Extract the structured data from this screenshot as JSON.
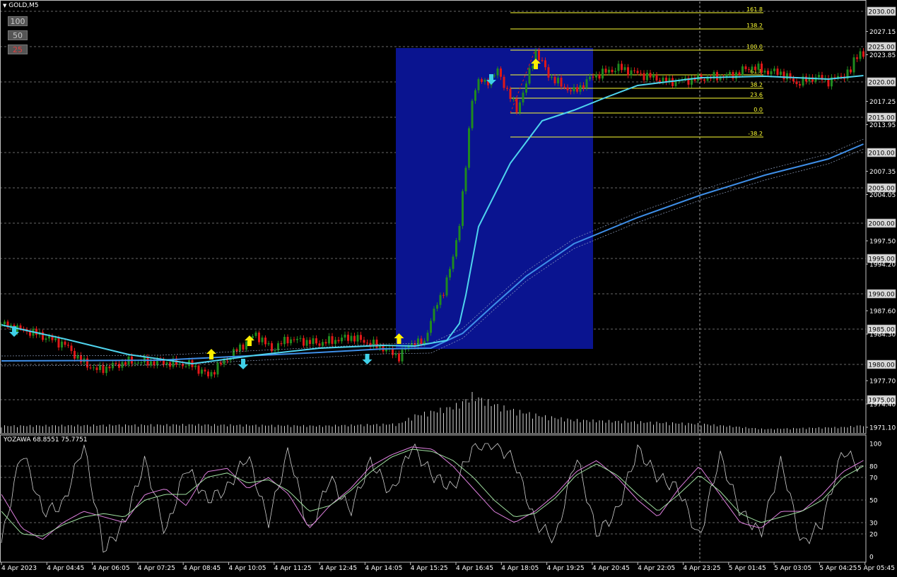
{
  "window": {
    "symbol_label": "GOLD,M5"
  },
  "zoom_buttons": [
    {
      "label": "100",
      "active": false
    },
    {
      "label": "50",
      "active": false
    },
    {
      "label": "25",
      "active": true
    }
  ],
  "price_axis": {
    "box_labels": [
      "2030.00",
      "2025.00",
      "2020.00",
      "2015.00",
      "2010.00",
      "2005.00",
      "2000.00",
      "1995.00",
      "1990.00",
      "1985.00",
      "1980.00",
      "1975.00"
    ],
    "plain_labels": [
      "2027.15",
      "2023.85",
      "2017.25",
      "2013.95",
      "2007.35",
      "2004.05",
      "1997.50",
      "1994.20",
      "1987.60",
      "1984.30",
      "1977.70",
      "1974.40",
      "1971.10"
    ]
  },
  "time_axis": {
    "labels": [
      "4 Apr 2023",
      "4 Apr 04:45",
      "4 Apr 06:05",
      "4 Apr 07:25",
      "4 Apr 08:45",
      "4 Apr 10:05",
      "4 Apr 11:25",
      "4 Apr 12:45",
      "4 Apr 14:05",
      "4 Apr 15:25",
      "4 Apr 16:45",
      "4 Apr 18:05",
      "4 Apr 19:25",
      "4 Apr 20:45",
      "4 Apr 22:05",
      "4 Apr 23:25",
      "5 Apr 01:45",
      "5 Apr 03:05",
      "5 Apr 04:25",
      "5 Apr 05:45"
    ]
  },
  "fibonacci": {
    "levels": [
      {
        "label": "161.8",
        "price": 2029.8
      },
      {
        "label": "138.2",
        "price": 2027.5
      },
      {
        "label": "100.0",
        "price": 2024.5
      },
      {
        "label": "61.8",
        "price": 2021.0
      },
      {
        "label": "38.2",
        "price": 2019.1
      },
      {
        "label": "23.6",
        "price": 2017.7
      },
      {
        "label": "0.0",
        "price": 2015.6
      },
      {
        "label": "-38.2",
        "price": 2012.2
      }
    ]
  },
  "oscillator": {
    "label": "YOZAWA 68.8551 75.7751",
    "axis_labels": [
      "100",
      "80",
      "70",
      "50",
      "30",
      "20",
      "0"
    ],
    "levels": [
      100,
      80,
      70,
      50,
      30,
      20,
      0
    ]
  },
  "colors": {
    "background": "#000000",
    "bull": "#1f8a1f",
    "bear": "#e01818",
    "fast_ma": "#4fd4ee",
    "slow_ma": "#3f8fe8",
    "fib": "#ffff33",
    "highlight_box": "#0a1490",
    "arrow_up": "#ffee00",
    "arrow_down": "#3fd0e8",
    "osc_main": "#d0d0d0",
    "osc_signal": "#e080e0",
    "osc_slow": "#a0e0a0"
  },
  "chart_data": {
    "type": "candlestick",
    "title": "GOLD,M5",
    "ylim": [
      1970.2,
      2031.4
    ],
    "close_path": [
      [
        0,
        1985.7
      ],
      [
        10,
        1984.5
      ],
      [
        20,
        1982.8
      ],
      [
        25,
        1980.5
      ],
      [
        30,
        1979.2
      ],
      [
        40,
        1980.4
      ],
      [
        50,
        1980.3
      ],
      [
        60,
        1979.9
      ],
      [
        65,
        1978.4
      ],
      [
        70,
        1980.5
      ],
      [
        80,
        1984.3
      ],
      [
        85,
        1982.1
      ],
      [
        90,
        1983.6
      ],
      [
        100,
        1983.0
      ],
      [
        110,
        1983.9
      ],
      [
        120,
        1982.3
      ],
      [
        125,
        1981.1
      ],
      [
        129,
        1983.1
      ],
      [
        133,
        1983.0
      ],
      [
        134,
        1985.0
      ],
      [
        136,
        1987.5
      ],
      [
        139,
        1990.5
      ],
      [
        142,
        1995.0
      ],
      [
        144,
        2000.2
      ],
      [
        146,
        2008.0
      ],
      [
        148,
        2017.8
      ],
      [
        150,
        2020.2
      ],
      [
        152,
        2019.8
      ],
      [
        156,
        2021.5
      ],
      [
        159,
        2018.8
      ],
      [
        162,
        2016.0
      ],
      [
        165,
        2019.8
      ],
      [
        168,
        2024.3
      ],
      [
        172,
        2021.0
      ],
      [
        176,
        2019.5
      ],
      [
        180,
        2018.6
      ],
      [
        186,
        2020.8
      ],
      [
        194,
        2022.0
      ],
      [
        200,
        2021.2
      ],
      [
        210,
        2020.0
      ],
      [
        220,
        2020.5
      ],
      [
        230,
        2021.0
      ],
      [
        236,
        2022.2
      ],
      [
        240,
        2021.5
      ],
      [
        245,
        2021.3
      ],
      [
        250,
        2019.8
      ],
      [
        256,
        2020.7
      ],
      [
        260,
        2020.1
      ],
      [
        264,
        2020.8
      ],
      [
        267,
        2021.5
      ],
      [
        268,
        2023.0
      ],
      [
        270,
        2024.5
      ],
      [
        271,
        2023.3
      ]
    ],
    "series": [
      {
        "name": "fast MA",
        "points": [
          [
            0,
            1985.6
          ],
          [
            20,
            1983.6
          ],
          [
            40,
            1981.4
          ],
          [
            60,
            1980.1
          ],
          [
            80,
            1981.3
          ],
          [
            100,
            1982.3
          ],
          [
            120,
            1982.7
          ],
          [
            130,
            1982.6
          ],
          [
            140,
            1983.4
          ],
          [
            144,
            1985.8
          ],
          [
            146,
            1989.8
          ],
          [
            150,
            1999.5
          ],
          [
            160,
            2008.5
          ],
          [
            170,
            2014.5
          ],
          [
            180,
            2016.0
          ],
          [
            190,
            2017.8
          ],
          [
            200,
            2019.5
          ],
          [
            220,
            2020.6
          ],
          [
            240,
            2020.8
          ],
          [
            260,
            2020.4
          ],
          [
            271,
            2020.9
          ]
        ]
      },
      {
        "name": "slow MA",
        "points": [
          [
            0,
            1980.5
          ],
          [
            50,
            1980.6
          ],
          [
            100,
            1981.7
          ],
          [
            120,
            1982.2
          ],
          [
            135,
            1982.3
          ],
          [
            145,
            1984.4
          ],
          [
            155,
            1988.5
          ],
          [
            165,
            1992.5
          ],
          [
            180,
            1997.1
          ],
          [
            200,
            2000.8
          ],
          [
            220,
            2004.0
          ],
          [
            240,
            2006.8
          ],
          [
            260,
            2009.1
          ],
          [
            271,
            2011.2
          ]
        ]
      }
    ],
    "highlight_range": {
      "x": [
        124,
        186
      ],
      "y": [
        1982.2,
        2024.8
      ]
    },
    "signals": [
      {
        "type": "down",
        "x": 4,
        "price": 1984.8
      },
      {
        "type": "up",
        "x": 66,
        "price": 1981.3
      },
      {
        "type": "up",
        "x": 78,
        "price": 1983.2
      },
      {
        "type": "down",
        "x": 76,
        "price": 1980.2
      },
      {
        "type": "down",
        "x": 115,
        "price": 1980.9
      },
      {
        "type": "up",
        "x": 125,
        "price": 1983.5
      },
      {
        "type": "down",
        "x": 154,
        "price": 2020.5
      },
      {
        "type": "up",
        "x": 168,
        "price": 2022.4
      }
    ],
    "volume_path": [
      [
        0,
        11
      ],
      [
        30,
        12
      ],
      [
        60,
        13
      ],
      [
        100,
        11
      ],
      [
        125,
        14
      ],
      [
        130,
        27
      ],
      [
        140,
        38
      ],
      [
        144,
        44
      ],
      [
        148,
        58
      ],
      [
        150,
        54
      ],
      [
        155,
        44
      ],
      [
        160,
        36
      ],
      [
        170,
        26
      ],
      [
        180,
        20
      ],
      [
        200,
        17
      ],
      [
        220,
        14
      ],
      [
        240,
        6
      ],
      [
        255,
        8
      ],
      [
        265,
        9
      ],
      [
        271,
        12
      ]
    ],
    "oscillator_series": [
      {
        "name": "main",
        "values": [
          12,
          95,
          40,
          45,
          100,
          5,
          30,
          85,
          20,
          80,
          50,
          60,
          90,
          30,
          95,
          20,
          70,
          40,
          85,
          55,
          98,
          72,
          60,
          98,
          100,
          85,
          30,
          15,
          90,
          20,
          40,
          95,
          70,
          60,
          15,
          90,
          40,
          20,
          85,
          10,
          30,
          95,
          75
        ]
      },
      {
        "name": "signal",
        "values": [
          55,
          25,
          15,
          30,
          40,
          35,
          30,
          55,
          60,
          45,
          75,
          78,
          60,
          70,
          55,
          25,
          45,
          60,
          80,
          90,
          97,
          95,
          80,
          60,
          40,
          30,
          40,
          55,
          75,
          85,
          70,
          50,
          35,
          60,
          80,
          55,
          30,
          25,
          40,
          40,
          55,
          75,
          85
        ]
      },
      {
        "name": "slow",
        "values": [
          40,
          20,
          18,
          28,
          35,
          38,
          35,
          50,
          55,
          55,
          70,
          74,
          65,
          68,
          58,
          40,
          45,
          58,
          75,
          88,
          95,
          93,
          85,
          70,
          50,
          35,
          38,
          52,
          72,
          82,
          72,
          55,
          40,
          55,
          72,
          58,
          38,
          30,
          35,
          40,
          50,
          70,
          80
        ]
      }
    ]
  }
}
